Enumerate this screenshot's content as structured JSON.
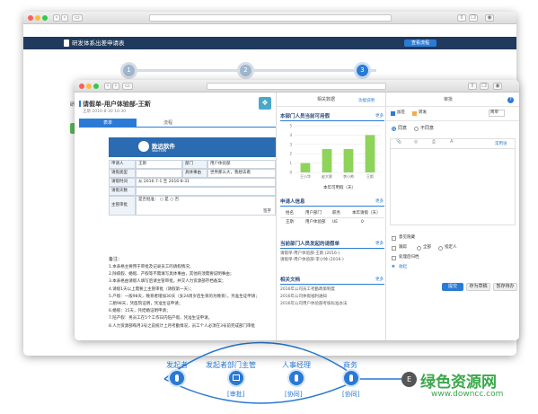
{
  "back_window": {
    "title": "研发体系出差申请表",
    "submit_button": "查看流程",
    "steps": [
      "1",
      "2",
      "3"
    ],
    "left_cut": "研"
  },
  "front_window": {
    "url": "",
    "form": {
      "title": "请假单-用户体验部-王斯",
      "subtitle": "王斯   2016-8-30 10:30",
      "tab_form": "表单",
      "tab_flow": "流程",
      "logo_cn": "致远软件",
      "logo_en": "SEEYON",
      "rows": [
        {
          "label": "申请人",
          "value": "王斯",
          "label2": "部门",
          "value2": "用户体验部"
        },
        {
          "label": "请假类型",
          "value": "",
          "label2": "具体事由",
          "value2": "世界那么大，我想去看"
        },
        {
          "label": "请假时间",
          "value": "从 2016-7-1 至 2016-8-31",
          "label2": "",
          "value2": ""
        },
        {
          "label": "请假天数",
          "value": "",
          "label2": "",
          "value2": ""
        },
        {
          "label": "主管审批",
          "value": "是否批准：  ○ 是   ○ 否",
          "label2": "",
          "value2": ""
        }
      ],
      "sign_label": "签字",
      "notes_title": "备注：",
      "notes": [
        "1.本表格主要用于审批及记录员工的请假情况；",
        "2.除病假、婚假、产假等不需填写具体事由，其他的须需要说明事由；",
        "3.本表格由请假人填写后请主管审批，并交人力资源部存档备案；",
        "4.请假1天以上需要上主管审批（请假第一天）；",
        "5.产假：一般98天，晚育者增加30天（女24周岁后生育的为晚育），凭准生证申请；",
        "     二胎98天，凭医院证明，凭准生证申请；",
        "6.婚假：15天，凭结婚证明申请；",
        "7.陪产假：男员工在5个工作日内陪产假，凭准生证申请。",
        "8.人力资源部每月3号之前统计上月考勤情况，员工个人必须在3号前完成部门审批"
      ]
    },
    "related": {
      "header": "相关数据",
      "link": "功能说明",
      "chart_title": "本部门人员当前可用假",
      "chart_more": "更多",
      "chart_caption": "本年可用假（天）",
      "applicant_title": "申请人信息",
      "applicant_more": "更多",
      "applicant_cols": [
        "姓名",
        "用户部门",
        "职务",
        "本年请假（天）"
      ],
      "applicant_row": [
        "王斯",
        "用户体验部",
        "UE",
        "0"
      ],
      "pending_title": "当前部门人员发起的请假单",
      "pending_more": "更多",
      "pending_items": [
        "请假单-用户体验部-王斯 (2016-)",
        "请假单-用户体验部-李小帅 (2016-)"
      ],
      "docs_title": "相关文档",
      "docs_more": "更多",
      "docs_items": [
        "2016年公司员工考勤政策制度",
        "2016年公司休假福利通知",
        "2016年公司用户体验部考核标准办法"
      ]
    },
    "approval": {
      "header": "审批",
      "tag1": "加签",
      "tag2": "转发",
      "sort": "简单",
      "agree": "同意",
      "disagree": "不同意",
      "common_phrases": "常用语",
      "tools": [
        "📎",
        "◎",
        "⎙",
        "A"
      ],
      "options": [
        "意见隐藏",
        "跟踪",
        "全部",
        "指定人",
        "处理后归档"
      ],
      "collapse": "收起",
      "submit": "提交",
      "save_draft": "存为草稿",
      "hold": "暂存待办"
    }
  },
  "chart_data": {
    "type": "bar",
    "title": "本部门人员当前可用假",
    "categories": [
      "王小华",
      "赵大胖",
      "李小帅",
      "王斯"
    ],
    "values": [
      1,
      2.5,
      2.5,
      4
    ],
    "yticks": [
      "0",
      "1",
      "2",
      "3",
      "4",
      "5"
    ],
    "ylim": [
      0,
      5
    ],
    "xlabel": "本年可用假（天）",
    "color": "#8ed35a"
  },
  "flow": {
    "nodes": [
      {
        "name": "发起者",
        "tag": ""
      },
      {
        "name": "发起者部门主管",
        "tag": "[审批]"
      },
      {
        "name": "人事经理",
        "tag": "[协同]"
      },
      {
        "name": "商务",
        "tag": "[协同]"
      }
    ],
    "end_label": "E",
    "watermark_cn": "绿色资源网",
    "watermark_url": "www.downcc.com"
  },
  "colors": {
    "accent": "#2b7bd6",
    "nav_dark": "#1f3a5c",
    "bar": "#8ed35a",
    "watermark": "#3aa84a"
  }
}
